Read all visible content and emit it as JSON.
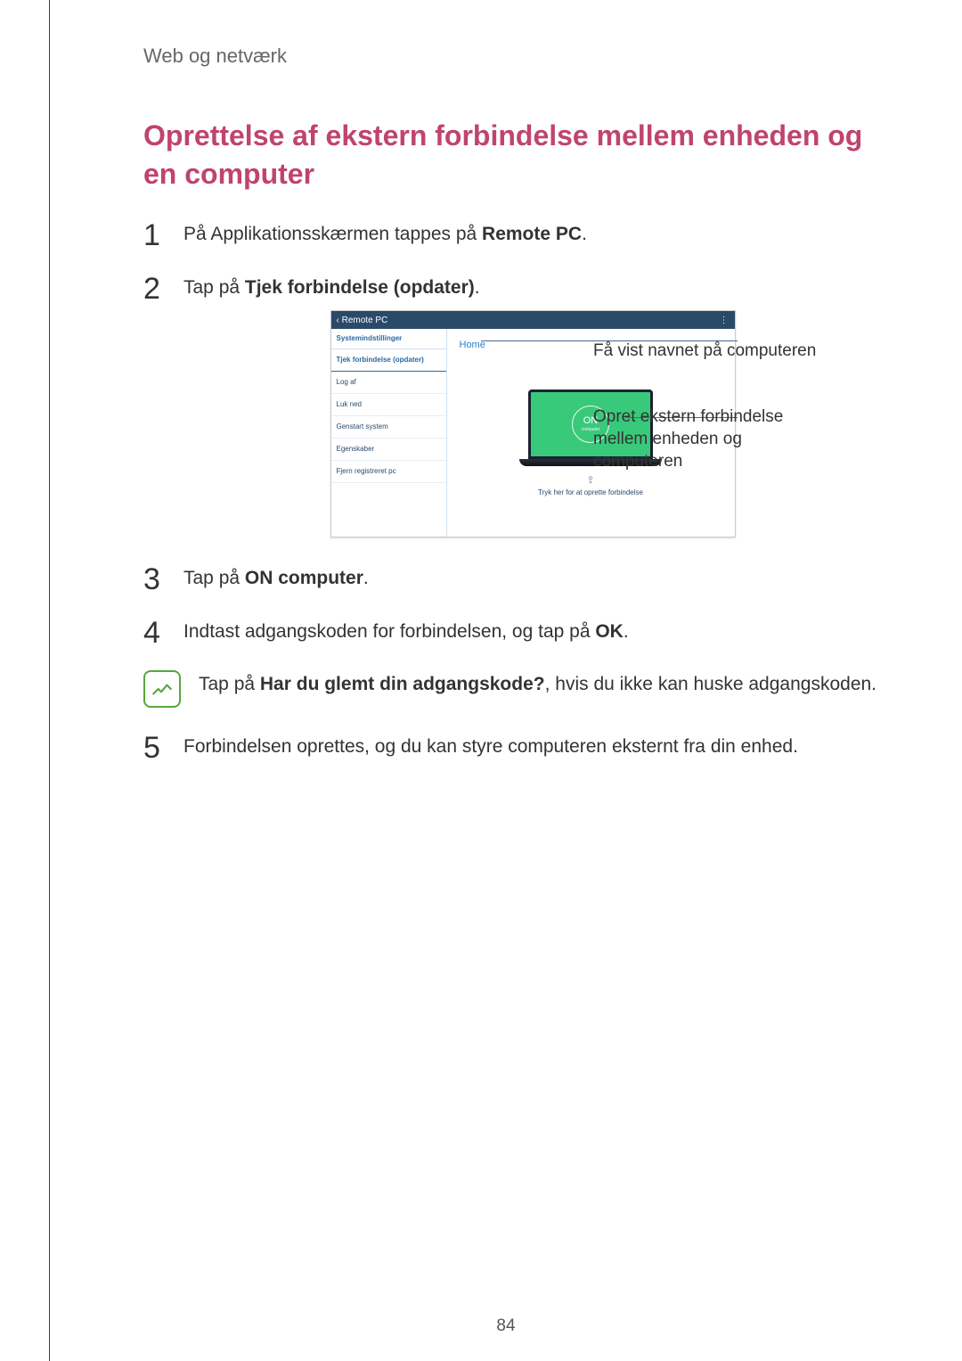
{
  "breadcrumb": "Web og netværk",
  "section_title": "Oprettelse af ekstern forbindelse mellem enheden og en computer",
  "steps": {
    "s1_pre": "På Applikationsskærmen tappes på ",
    "s1_bold": "Remote PC",
    "s1_post": ".",
    "s2_pre": "Tap på ",
    "s2_bold": "Tjek forbindelse (opdater)",
    "s2_post": ".",
    "s3_pre": "Tap på ",
    "s3_bold": "ON computer",
    "s3_post": ".",
    "s4_pre": "Indtast adgangskoden for forbindelsen, og tap på ",
    "s4_bold": "OK",
    "s4_post": ".",
    "s5": "Forbindelsen oprettes, og du kan styre computeren eksternt fra din enhed."
  },
  "note": {
    "pre": "Tap på ",
    "bold": "Har du glemt din adgangskode?",
    "post": ", hvis du ikke kan huske adgangskoden."
  },
  "screenshot": {
    "topbar_title": "Remote PC",
    "sidebar_header": "Systemindstillinger",
    "sidebar_items": [
      "Tjek forbindelse (opdater)",
      "Log af",
      "Luk ned",
      "Genstart system",
      "Egenskaber",
      "Fjern registreret pc"
    ],
    "tab_label": "Home",
    "on_label": "ON",
    "on_sub": "computer",
    "tap_hint": "Tryk her for at oprette forbindelse"
  },
  "callouts": {
    "c1": "Få vist navnet på computeren",
    "c2": "Opret ekstern forbindelse mellem enheden og computeren"
  },
  "page_number": "84"
}
